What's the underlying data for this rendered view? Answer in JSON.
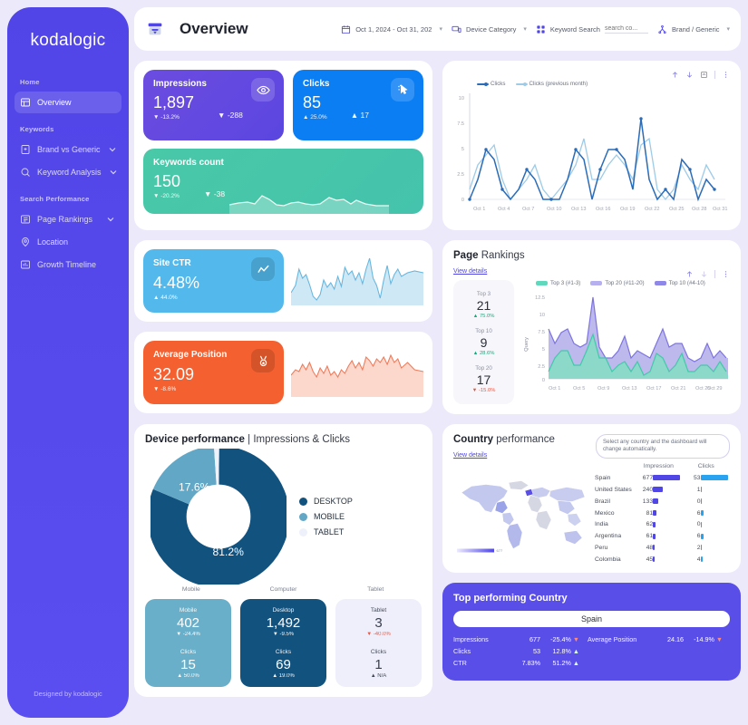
{
  "sidebar": {
    "logo": "kodalogic",
    "credit": "Designed by kodalogic",
    "sections": [
      {
        "label": "Home",
        "items": [
          {
            "label": "Overview",
            "icon": "overview-icon",
            "active": true,
            "chevron": false
          }
        ]
      },
      {
        "label": "Keywords",
        "items": [
          {
            "label": "Brand vs Generic",
            "icon": "brand-icon",
            "active": false,
            "chevron": true
          },
          {
            "label": "Keyword Analysis",
            "icon": "keyword-icon",
            "active": false,
            "chevron": true
          }
        ]
      },
      {
        "label": "Search Performance",
        "items": [
          {
            "label": "Page Rankings",
            "icon": "rankings-icon",
            "active": false,
            "chevron": true
          },
          {
            "label": "Location",
            "icon": "location-icon",
            "active": false,
            "chevron": false
          },
          {
            "label": "Growth Timeline",
            "icon": "growth-icon",
            "active": false,
            "chevron": false
          }
        ]
      }
    ]
  },
  "header": {
    "title": "Overview",
    "date_filter": "Oct 1, 2024 - Oct 31, 202",
    "device_filter": "Device Category",
    "keyword_search_label": "Keyword Search",
    "keyword_search_placeholder": "search co...",
    "brand_filter": "Brand / Generic"
  },
  "kpis": {
    "impressions": {
      "title": "Impressions",
      "value": "1,897",
      "delta": "-13.2%",
      "abs": "-288",
      "dir": "down"
    },
    "clicks": {
      "title": "Clicks",
      "value": "85",
      "delta": "25.0%",
      "abs": "17",
      "dir": "up"
    },
    "keywords": {
      "title": "Keywords count",
      "value": "150",
      "delta": "-20.2%",
      "abs": "-38",
      "dir": "down"
    },
    "ctr": {
      "title": "Site CTR",
      "value": "4.48%",
      "delta": "44.0%",
      "dir": "up"
    },
    "position": {
      "title": "Average Position",
      "value": "32.09",
      "delta": "-8.6%",
      "dir": "down"
    }
  },
  "chart_data": [
    {
      "type": "line",
      "title": "Clicks",
      "xlabel": "",
      "ylabel": "",
      "ylim": [
        0,
        10
      ],
      "yticks": [
        "10",
        "7.5",
        "5",
        "2.5",
        "0"
      ],
      "x": [
        "Oct 1",
        "Oct 4",
        "Oct 7",
        "Oct 10",
        "Oct 13",
        "Oct 16",
        "Oct 19",
        "Oct 22",
        "Oct 25",
        "Oct 28",
        "Oct 31"
      ],
      "legend": [
        {
          "name": "Clicks",
          "color": "#2b6cb8"
        },
        {
          "name": "Clicks (previous month)",
          "color": "#9ecbe8"
        }
      ],
      "series": [
        {
          "name": "Clicks",
          "color": "#2b6cb8",
          "values": [
            0,
            2,
            5,
            4,
            1,
            0,
            1,
            3,
            2,
            0,
            0,
            0,
            2,
            5,
            4,
            0,
            3,
            5,
            5,
            4,
            1,
            8,
            2,
            0,
            1,
            0,
            4,
            3,
            0,
            2,
            1
          ]
        },
        {
          "name": "Clicks (previous month)",
          "color": "#9ecbe8",
          "values": [
            1,
            3,
            4,
            5,
            2,
            0,
            1,
            2,
            3,
            1,
            0,
            1,
            2,
            3,
            6,
            2,
            2,
            3,
            4,
            3,
            2,
            5,
            6,
            1,
            0,
            1,
            3,
            2,
            1,
            3,
            2
          ]
        }
      ]
    },
    {
      "type": "area",
      "title": "Page Rankings",
      "ylabel": "Query",
      "ylim": [
        0,
        12.5
      ],
      "yticks": [
        "12.5",
        "10",
        "7.5",
        "5",
        "2.5",
        "0"
      ],
      "x": [
        "Oct 1",
        "Oct 5",
        "Oct 9",
        "Oct 13",
        "Oct 17",
        "Oct 21",
        "Oct 25",
        "Oct 29"
      ],
      "legend": [
        {
          "name": "Top 3 (#1-3)",
          "color": "#5fd8bd"
        },
        {
          "name": "Top 20 (#11-20)",
          "color": "#b6b0ee"
        },
        {
          "name": "Top 10 (#4-10)",
          "color": "#8f88e8"
        }
      ],
      "series": [
        {
          "name": "Top 3 (#1-3)",
          "color": "#5fd8bd",
          "values": [
            1,
            3,
            4,
            4,
            2,
            2,
            4,
            6.2,
            3,
            3,
            1,
            2,
            2.5,
            1,
            2.5,
            0.5,
            1,
            3.5,
            3,
            1,
            2,
            3.5,
            1,
            1,
            2,
            2,
            1,
            2.5,
            1,
            0.5
          ]
        },
        {
          "name": "Top 10 (#4-10)",
          "color": "#8f88e8",
          "values": [
            7,
            5,
            6.5,
            7,
            5,
            4.5,
            5,
            12,
            4.5,
            3,
            3,
            4,
            6,
            3,
            4,
            3.5,
            3,
            5,
            7,
            4.5,
            5,
            5,
            3,
            2.5,
            3,
            5,
            3,
            4,
            3,
            3
          ]
        }
      ]
    },
    {
      "type": "pie",
      "title": "Device performance | Impressions & Clicks",
      "labels": [
        "DESKTOP",
        "MOBILE",
        "TABLET"
      ],
      "values": [
        81.2,
        17.6,
        1.2
      ],
      "display_values": [
        "81.2%",
        "17.6%",
        ""
      ],
      "colors": [
        "#12527f",
        "#62a8c6",
        "#eef0fa"
      ],
      "axis_labels": [
        "Mobile",
        "Computer",
        "Tablet"
      ]
    }
  ],
  "clicks_panel": {
    "tools": [
      "up-arrow-icon",
      "down-arrow-icon",
      "export-icon",
      "kebab-menu-icon"
    ]
  },
  "rankings": {
    "title_bold": "Page",
    "title_rest": " Rankings",
    "view_details": "View details",
    "tiles": [
      {
        "label": "Top 3",
        "value": "21",
        "delta": "75.0%",
        "dir": "up"
      },
      {
        "label": "Top 10",
        "value": "9",
        "delta": "28.6%",
        "dir": "up"
      },
      {
        "label": "Top 20",
        "value": "17",
        "delta": "-15.0%",
        "dir": "down"
      }
    ]
  },
  "device": {
    "title_bold": "Device performance",
    "title_rest": " | Impressions & Clicks",
    "cards": [
      {
        "name": "Mobile",
        "impressions": "402",
        "imp_delta": "-24.4%",
        "imp_dir": "down",
        "clicks_label": "Clicks",
        "clicks": "15",
        "clicks_delta": "50.0%",
        "clicks_dir": "up",
        "theme": "mobile"
      },
      {
        "name": "Desktop",
        "impressions": "1,492",
        "imp_delta": "-9.5%",
        "imp_dir": "down",
        "clicks_label": "Clicks",
        "clicks": "69",
        "clicks_delta": "19.0%",
        "clicks_dir": "up",
        "theme": "desktop"
      },
      {
        "name": "Tablet",
        "impressions": "3",
        "imp_delta": "-40.0%",
        "imp_dir": "down",
        "clicks_label": "Clicks",
        "clicks": "1",
        "clicks_delta": "N/A",
        "clicks_dir": "up",
        "theme": "tablet"
      }
    ]
  },
  "country": {
    "title_bold": "Country",
    "title_rest": " performance",
    "view_details": "View details",
    "tooltip": "Select any country and the dashboard will change automatically.",
    "columns": [
      "Impression",
      "Clicks"
    ],
    "map_legend_max": "677",
    "rows": [
      {
        "name": "Spain",
        "impressions": 677,
        "clicks": 53
      },
      {
        "name": "United States",
        "impressions": 240,
        "clicks": 1
      },
      {
        "name": "Brazil",
        "impressions": 133,
        "clicks": 0
      },
      {
        "name": "Mexico",
        "impressions": 81,
        "clicks": 6
      },
      {
        "name": "India",
        "impressions": 62,
        "clicks": 0
      },
      {
        "name": "Argentina",
        "impressions": 61,
        "clicks": 6
      },
      {
        "name": "Peru",
        "impressions": 48,
        "clicks": 2
      },
      {
        "name": "Colombia",
        "impressions": 45,
        "clicks": 4
      }
    ]
  },
  "top_country": {
    "title": "Top performing Country",
    "selected": "Spain",
    "metrics": [
      {
        "label": "Impressions",
        "value": "677",
        "delta": "-25.4%",
        "dir": "down"
      },
      {
        "label": "Clicks",
        "value": "53",
        "delta": "12.8%",
        "dir": "up"
      },
      {
        "label": "CTR",
        "value": "7.83%",
        "delta": "51.2%",
        "dir": "up"
      }
    ],
    "side_metric": {
      "label": "Average Position",
      "value": "24.16",
      "delta": "-14.9%",
      "dir": "down"
    }
  }
}
